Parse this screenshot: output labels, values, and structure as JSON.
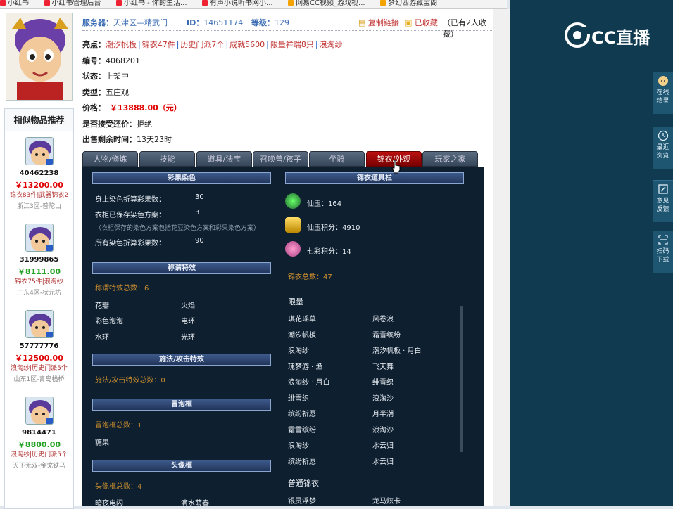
{
  "bookmarks": [
    "小红书",
    "小红书管理后台",
    "小红书 - 你的生活...",
    "有声小说听书网小...",
    "网易CC视频_游戏视...",
    "梦幻西游藏宝阁"
  ],
  "header": {
    "server_label": "服务器：",
    "server": "天津区—精武门",
    "id_label": "ID：",
    "id": "14651174",
    "level_label": "等级：",
    "level": "129",
    "copy_link": "复制链接",
    "favorited": "已收藏",
    "fav_count": "（已有2人收藏）"
  },
  "highlights_label": "亮点：",
  "highlights": [
    "潮汐帆板",
    "锦衣47件",
    "历史门派7个",
    "成就5600",
    "限量祥瑞8只",
    "浪淘纱"
  ],
  "fields": [
    {
      "label": "编号：",
      "value": "4068201"
    },
    {
      "label": "状态：",
      "value": "上架中"
    },
    {
      "label": "类型：",
      "value": "五庄观"
    },
    {
      "label": "价格：",
      "value": "￥13888.00（元）"
    },
    {
      "label": "是否接受还价：",
      "value": "拒绝"
    },
    {
      "label": "出售剩余时间：",
      "value": "13天23时"
    }
  ],
  "tabs": [
    "人物/修炼",
    "技能",
    "道具/法宝",
    "召唤兽/孩子",
    "坐骑",
    "锦衣/外观",
    "玩家之家"
  ],
  "active_tab": 5,
  "similar": {
    "title": "相似物品推荐",
    "items": [
      {
        "id": "40462238",
        "price": "￥13200.00",
        "tags": "锦衣83件|武器锦衣2",
        "area": "浙江3区-普陀山",
        "color": "red"
      },
      {
        "id": "31999865",
        "price": "￥8111.00",
        "tags": "锦衣75件|浪淘纱",
        "area": "广东4区-状元坊",
        "color": "green"
      },
      {
        "id": "57777776",
        "price": "￥12500.00",
        "tags": "浪淘纱|历史门派5个",
        "area": "山东1区-青岛栈桥",
        "color": "red"
      },
      {
        "id": "9814471",
        "price": "￥8800.00",
        "tags": "浪淘纱|历史门派5个",
        "area": "天下无双-金戈铁马",
        "color": "green"
      }
    ]
  },
  "panel": {
    "s1": {
      "title": "彩果染色",
      "r1l": "身上染色折算彩果数：",
      "r1v": "30",
      "r2l": "衣柜已保存染色方案：",
      "r2v": "3",
      "note": "（衣柜保存的染色方案包括花豆染色方案和彩果染色方案）",
      "r3l": "所有染色折算彩果数：",
      "r3v": "90"
    },
    "s2": {
      "title": "称谓特效",
      "count": "称谓特效总数：6",
      "items": [
        "花瓣",
        "火焰",
        "彩色泡泡",
        "电环",
        "水环",
        "光环"
      ]
    },
    "s3": {
      "title": "施法/攻击特效",
      "count": "施法/攻击特效总数：0"
    },
    "s4": {
      "title": "冒泡框",
      "count": "冒泡框总数：1",
      "items": [
        "糖果"
      ]
    },
    "s5": {
      "title": "头像框",
      "count": "头像框总数：4",
      "items": [
        "暗夜电闪",
        "滴水萌春"
      ]
    },
    "s6": {
      "title": "锦衣道具栏",
      "xy": "仙玉：164",
      "xyjf": "仙玉积分：4910",
      "qc": "七彩积分：14",
      "total": "锦衣总数：47",
      "limited": "限量",
      "common": "普通锦衣",
      "items": [
        [
          "琪花瑶草",
          "风卷浪"
        ],
        [
          "潮汐帆板",
          "霜雪缤纷"
        ],
        [
          "浪淘纱",
          "潮汐帆板 · 月白"
        ],
        [
          "瑰梦游 · 渔",
          "飞天舞"
        ],
        [
          "浪淘纱 · 月白",
          "绯雪织"
        ],
        [
          "绯雪织",
          "浪淘沙"
        ],
        [
          "缤纷祈愿",
          "月半潮"
        ],
        [
          "霜雪缤纷",
          "浪淘沙"
        ],
        [
          "浪淘纱",
          "水云归"
        ],
        [
          "缤纷祈愿",
          "水云归"
        ]
      ],
      "common_items": [
        "银灵浮梦",
        "龙马炫卡"
      ]
    }
  },
  "right": {
    "brand": "CC直播",
    "side": [
      {
        "l1": "在线",
        "l2": "精灵"
      },
      {
        "l1": "最近",
        "l2": "浏览"
      },
      {
        "l1": "意见",
        "l2": "反馈"
      },
      {
        "l1": "扫码",
        "l2": "下载"
      }
    ]
  }
}
